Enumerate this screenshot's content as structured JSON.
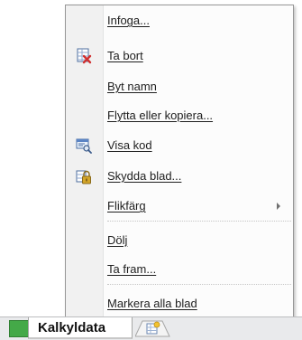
{
  "context_menu": {
    "items": [
      {
        "label": "Infoga...",
        "icon": null
      },
      {
        "label": "Ta bort",
        "icon": "delete-sheet-icon"
      },
      {
        "label": "Byt namn",
        "icon": null
      },
      {
        "label": "Flytta eller kopiera...",
        "icon": null
      },
      {
        "label": "Visa kod",
        "icon": "view-code-icon"
      },
      {
        "label": "Skydda blad...",
        "icon": "protect-sheet-icon"
      },
      {
        "label": "Flikfärg",
        "icon": null,
        "submenu": true
      },
      {
        "label": "Dölj",
        "icon": null
      },
      {
        "label": "Ta fram...",
        "icon": null
      },
      {
        "label": "Markera alla blad",
        "icon": null
      }
    ]
  },
  "sheet_tabs": {
    "active_label": "Kalkyldata",
    "new_sheet_icon": "insert-worksheet-icon"
  },
  "colors": {
    "tab_green": "#44a948",
    "delete_red": "#d03030",
    "lock_gold": "#d4a62a"
  }
}
